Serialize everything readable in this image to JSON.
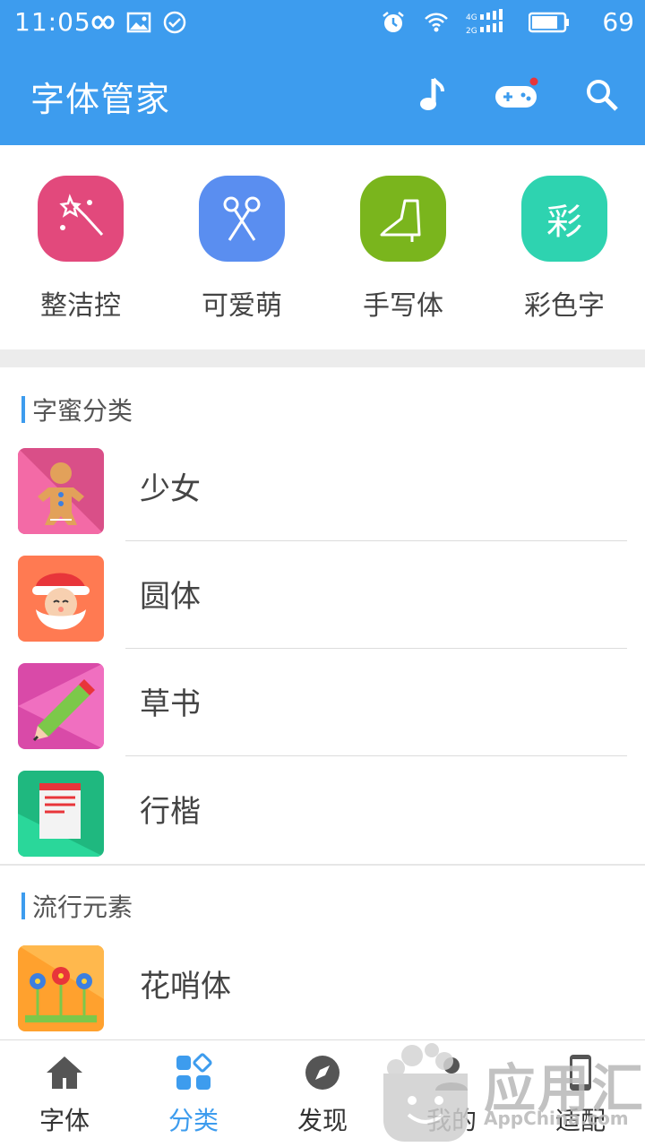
{
  "status_bar": {
    "time": "11:05",
    "battery": "69"
  },
  "toolbar": {
    "title": "字体管家",
    "icons": [
      "music-note-icon",
      "gamepad-icon",
      "search-icon"
    ],
    "accent": "#3d9cee"
  },
  "quick_categories": [
    {
      "label": "整洁控",
      "icon": "magic-wand-icon",
      "color": "#e2497c"
    },
    {
      "label": "可爱萌",
      "icon": "scissors-icon",
      "color": "#5a8ef0"
    },
    {
      "label": "手写体",
      "icon": "high-heel-icon",
      "color": "#7ab51d"
    },
    {
      "label": "彩色字",
      "icon": "cai-character-icon",
      "color": "#2ed3b0",
      "glyph": "彩"
    }
  ],
  "sections": [
    {
      "title": "字蜜分类",
      "items": [
        {
          "label": "少女",
          "icon": "gingerbread-icon",
          "color": "#d94f88"
        },
        {
          "label": "圆体",
          "icon": "santa-icon",
          "color": "#ff7a52"
        },
        {
          "label": "草书",
          "icon": "pencil-icon",
          "color": "#d94aa8"
        },
        {
          "label": "行楷",
          "icon": "notepad-icon",
          "color": "#1fb87f"
        }
      ]
    },
    {
      "title": "流行元素",
      "items": [
        {
          "label": "花哨体",
          "icon": "flowers-icon",
          "color": "#ffa12e"
        }
      ]
    }
  ],
  "bottom_nav": [
    {
      "label": "字体",
      "icon": "home-icon",
      "active": false
    },
    {
      "label": "分类",
      "icon": "category-grid-icon",
      "active": true
    },
    {
      "label": "发现",
      "icon": "compass-icon",
      "active": false
    },
    {
      "label": "我的",
      "icon": "person-icon",
      "active": false
    },
    {
      "label": "适配",
      "icon": "phone-icon",
      "active": false
    }
  ],
  "watermark": {
    "text": "应用汇",
    "sub": "AppChina.com"
  }
}
